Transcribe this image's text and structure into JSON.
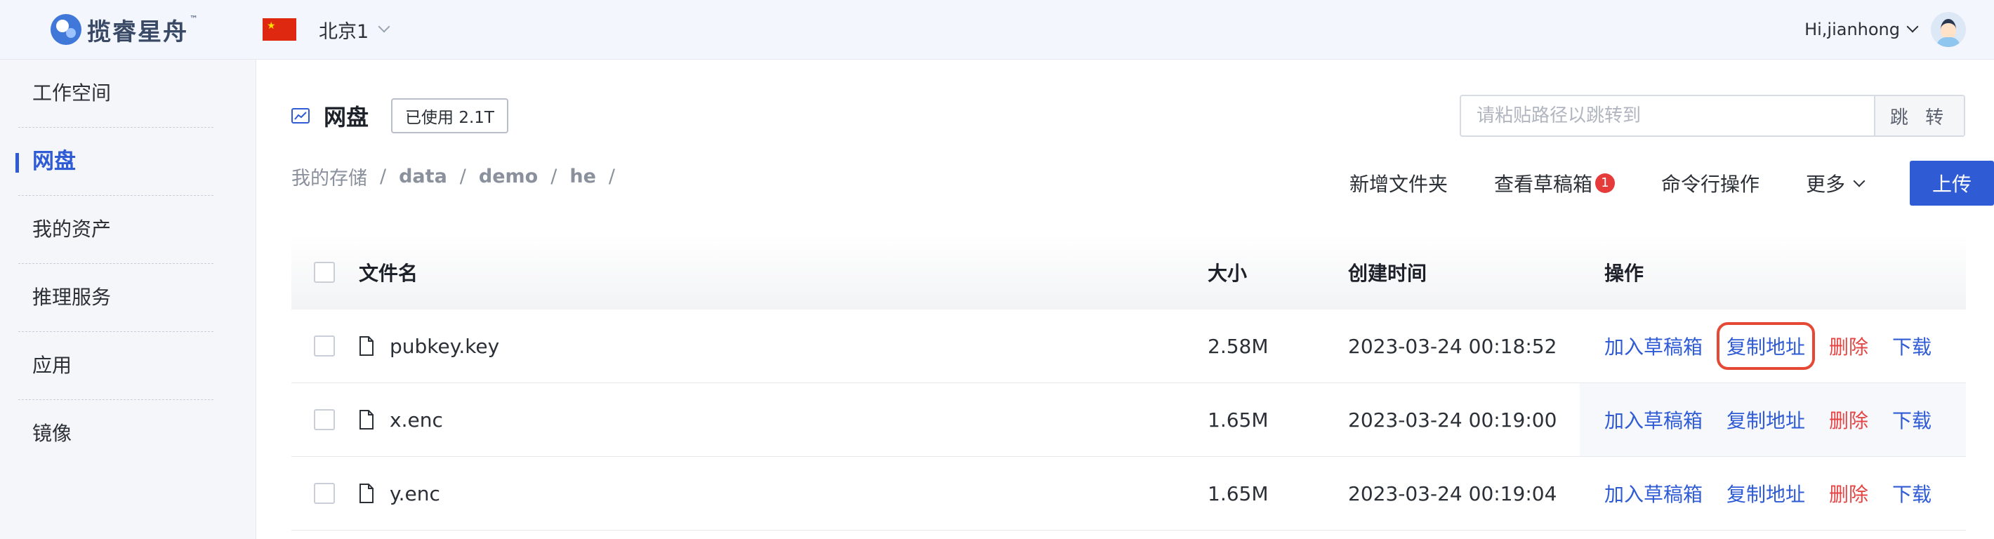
{
  "app": {
    "logo_text": "揽睿星舟",
    "logo_tm": "™",
    "region": "北京1",
    "user_greeting": "Hi,jianhong"
  },
  "sidebar": {
    "items": [
      {
        "label": "工作空间"
      },
      {
        "label": "网盘"
      },
      {
        "label": "我的资产"
      },
      {
        "label": "推理服务"
      },
      {
        "label": "应用"
      },
      {
        "label": "镜像"
      }
    ],
    "active": "网盘"
  },
  "main": {
    "title": "网盘",
    "usage": "已使用 2.1T",
    "jump_placeholder": "请粘贴路径以跳转到",
    "jump_button": "跳 转",
    "breadcrumb": [
      {
        "label": "我的存储",
        "bold": false
      },
      {
        "label": "data",
        "bold": true
      },
      {
        "label": "demo",
        "bold": true
      },
      {
        "label": "he",
        "bold": true
      }
    ],
    "breadcrumb_sep": "/",
    "toolbar": {
      "new_folder": "新增文件夹",
      "view_drafts": "查看草稿箱",
      "drafts_count": "1",
      "cli": "命令行操作",
      "more": "更多",
      "upload": "上传"
    },
    "table": {
      "headers": {
        "name": "文件名",
        "size": "大小",
        "created": "创建时间",
        "actions": "操作"
      },
      "rows": [
        {
          "name": "pubkey.key",
          "size": "2.58M",
          "created": "2023-03-24 00:18:52"
        },
        {
          "name": "x.enc",
          "size": "1.65M",
          "created": "2023-03-24 00:19:00"
        },
        {
          "name": "y.enc",
          "size": "1.65M",
          "created": "2023-03-24 00:19:04"
        }
      ],
      "actions": {
        "add_draft": "加入草稿箱",
        "copy_path": "复制地址",
        "delete": "删除",
        "download": "下载"
      }
    }
  },
  "colors": {
    "accent": "#2f5bd4",
    "danger": "#e54545",
    "highlight_box": "#e54935"
  }
}
